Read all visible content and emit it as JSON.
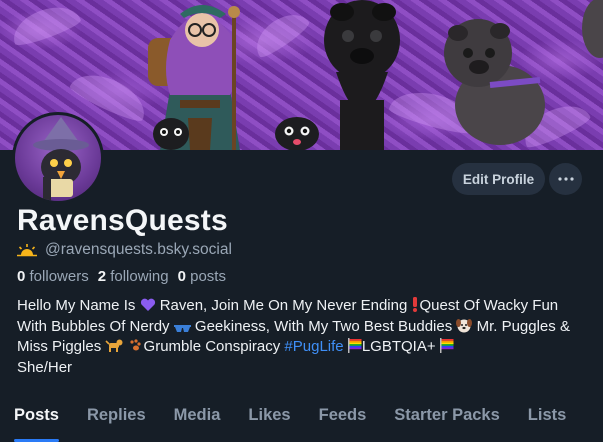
{
  "profile": {
    "display_name": "RavensQuests",
    "handle": "@ravensquests.bsky.social",
    "handle_icon": "sun-icon",
    "followers_count": "0",
    "followers_label": "followers",
    "following_count": "2",
    "following_label": "following",
    "posts_count": "0",
    "posts_label": "posts"
  },
  "actions": {
    "edit_profile_label": "Edit Profile",
    "more_icon": "ellipsis-icon"
  },
  "bio": {
    "p1": "Hello My Name Is ",
    "p2": " Raven, Join Me On My Never Ending ",
    "p3": "Quest Of Wacky Fun With Bubbles Of Nerdy",
    "p4": " Geekiness, With My Two Best Buddies ",
    "p5": " Mr. Puggles & Miss Piggles ",
    "p6": "Grumble Conspiracy ",
    "hashtag": "#PugLife",
    "p7": " ",
    "p8": "LGBTQIA+",
    "p9": "She/Her"
  },
  "tabs": [
    {
      "label": "Posts",
      "active": true
    },
    {
      "label": "Replies"
    },
    {
      "label": "Media"
    },
    {
      "label": "Likes"
    },
    {
      "label": "Feeds"
    },
    {
      "label": "Starter Packs"
    },
    {
      "label": "Lists"
    }
  ],
  "colors": {
    "background": "#161e27",
    "accent": "#2a7bf6",
    "hashtag": "#3f8ff7",
    "button_bg": "#263140",
    "muted_text": "#9aa7b6",
    "banner_purple": "#7b3fb3"
  }
}
